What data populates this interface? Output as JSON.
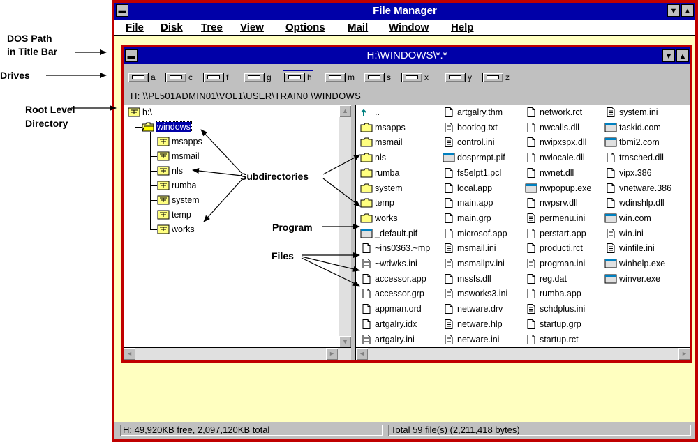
{
  "annotations": {
    "dos_path": [
      "DOS Path",
      "in Title Bar"
    ],
    "drives": "Drives",
    "root_level": [
      "Root Level",
      "Directory"
    ],
    "subdirectories": "Subdirectories",
    "program": "Program",
    "files": "Files"
  },
  "app": {
    "title": "File Manager"
  },
  "menus": [
    "File",
    "Disk",
    "Tree",
    "View",
    "Options",
    "Mail",
    "Window",
    "Help"
  ],
  "child": {
    "title": "H:\\WINDOWS\\*.*"
  },
  "drives": [
    "a",
    "c",
    "f",
    "g",
    "h",
    "m",
    "s",
    "x",
    "y",
    "z"
  ],
  "selected_drive": "h",
  "network_path": "H: \\\\PL501ADMIN01\\VOL1\\USER\\TRAIN0  \\WINDOWS",
  "tree": {
    "root": "h:\\",
    "selected": "windows",
    "children": [
      "msapps",
      "msmail",
      "nls",
      "rumba",
      "system",
      "temp",
      "works"
    ]
  },
  "files": {
    "columns": [
      [
        {
          "name": "..",
          "icon": "up-arrow-icon"
        },
        {
          "name": "msapps",
          "icon": "folder-icon"
        },
        {
          "name": "msmail",
          "icon": "folder-icon"
        },
        {
          "name": "nls",
          "icon": "folder-icon"
        },
        {
          "name": "rumba",
          "icon": "folder-icon"
        },
        {
          "name": "system",
          "icon": "folder-icon"
        },
        {
          "name": "temp",
          "icon": "folder-icon"
        },
        {
          "name": "works",
          "icon": "folder-icon"
        },
        {
          "name": "_default.pif",
          "icon": "program-icon"
        },
        {
          "name": "~ins0363.~mp",
          "icon": "file-icon"
        },
        {
          "name": "~wdwks.ini",
          "icon": "document-icon"
        },
        {
          "name": "accessor.app",
          "icon": "file-icon"
        },
        {
          "name": "accessor.grp",
          "icon": "file-icon"
        },
        {
          "name": "appman.ord",
          "icon": "file-icon"
        },
        {
          "name": "artgalry.idx",
          "icon": "file-icon"
        },
        {
          "name": "artgalry.ini",
          "icon": "document-icon"
        }
      ],
      [
        {
          "name": "artgalry.thm",
          "icon": "file-icon"
        },
        {
          "name": "bootlog.txt",
          "icon": "document-icon"
        },
        {
          "name": "control.ini",
          "icon": "document-icon"
        },
        {
          "name": "dosprmpt.pif",
          "icon": "program-icon"
        },
        {
          "name": "fs5elpt1.pcl",
          "icon": "file-icon"
        },
        {
          "name": "local.app",
          "icon": "file-icon"
        },
        {
          "name": "main.app",
          "icon": "file-icon"
        },
        {
          "name": "main.grp",
          "icon": "file-icon"
        },
        {
          "name": "microsof.app",
          "icon": "file-icon"
        },
        {
          "name": "msmail.ini",
          "icon": "document-icon"
        },
        {
          "name": "msmailpv.ini",
          "icon": "document-icon"
        },
        {
          "name": "mssfs.dll",
          "icon": "file-icon"
        },
        {
          "name": "msworks3.ini",
          "icon": "document-icon"
        },
        {
          "name": "netware.drv",
          "icon": "file-icon"
        },
        {
          "name": "netware.hlp",
          "icon": "document-icon"
        },
        {
          "name": "netware.ini",
          "icon": "document-icon"
        }
      ],
      [
        {
          "name": "network.rct",
          "icon": "file-icon"
        },
        {
          "name": "nwcalls.dll",
          "icon": "file-icon"
        },
        {
          "name": "nwipxspx.dll",
          "icon": "file-icon"
        },
        {
          "name": "nwlocale.dll",
          "icon": "file-icon"
        },
        {
          "name": "nwnet.dll",
          "icon": "file-icon"
        },
        {
          "name": "nwpopup.exe",
          "icon": "program-icon"
        },
        {
          "name": "nwpsrv.dll",
          "icon": "file-icon"
        },
        {
          "name": "permenu.ini",
          "icon": "document-icon"
        },
        {
          "name": "perstart.app",
          "icon": "file-icon"
        },
        {
          "name": "producti.rct",
          "icon": "file-icon"
        },
        {
          "name": "progman.ini",
          "icon": "document-icon"
        },
        {
          "name": "reg.dat",
          "icon": "file-icon"
        },
        {
          "name": "rumba.app",
          "icon": "file-icon"
        },
        {
          "name": "schdplus.ini",
          "icon": "document-icon"
        },
        {
          "name": "startup.grp",
          "icon": "file-icon"
        },
        {
          "name": "startup.rct",
          "icon": "file-icon"
        }
      ],
      [
        {
          "name": "system.ini",
          "icon": "document-icon"
        },
        {
          "name": "taskid.com",
          "icon": "program-icon"
        },
        {
          "name": "tbmi2.com",
          "icon": "program-icon"
        },
        {
          "name": "trnsched.dll",
          "icon": "file-icon"
        },
        {
          "name": "vipx.386",
          "icon": "file-icon"
        },
        {
          "name": "vnetware.386",
          "icon": "file-icon"
        },
        {
          "name": "wdinshlp.dll",
          "icon": "file-icon"
        },
        {
          "name": "win.com",
          "icon": "program-icon"
        },
        {
          "name": "win.ini",
          "icon": "document-icon"
        },
        {
          "name": "winfile.ini",
          "icon": "document-icon"
        },
        {
          "name": "winhelp.exe",
          "icon": "program-icon"
        },
        {
          "name": "winver.exe",
          "icon": "program-icon"
        }
      ]
    ]
  },
  "status": {
    "left": "H: 49,920KB free,  2,097,120KB total",
    "right": "Total 59 file(s) (2,211,418 bytes)"
  },
  "colors": {
    "title_bar": "#0000a8",
    "window_frame": "#c00000",
    "workspace": "#ffffc0",
    "chrome": "#c0c0c0"
  }
}
